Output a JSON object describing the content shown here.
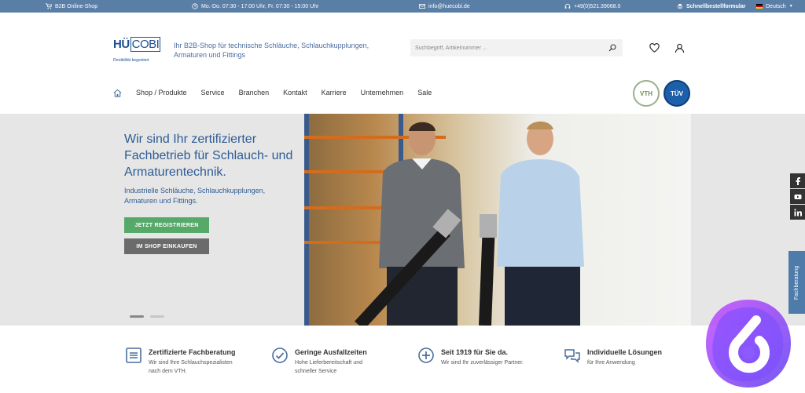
{
  "topbar": {
    "shop_label": "B2B Online-Shop",
    "hours": "Mo.-Do. 07:30 - 17:00 Uhr, Fr. 07:30 - 15:00 Uhr",
    "email": "info@huecobi.de",
    "phone": "+49(0)521.39068.0",
    "quick_order": "Schnellbestellformular",
    "language": "Deutsch"
  },
  "header": {
    "logo_hu": "HÜ",
    "logo_cobi": "COBI",
    "logo_tag": "Flexibilität begeistert",
    "tagline": "Ihr B2B-Shop für technische Schläuche, Schlauchkupplungen, Armaturen und Fittings",
    "search_placeholder": "Suchbegriff, Artikelnummer ..."
  },
  "nav": {
    "items": [
      "Shop / Produkte",
      "Service",
      "Branchen",
      "Kontakt",
      "Karriere",
      "Unternehmen",
      "Sale"
    ],
    "badge_vth": "VTH",
    "badge_tuv": "TÜV"
  },
  "hero": {
    "title": "Wir sind Ihr zertifizierter Fachbetrieb für Schlauch- und Armaturentechnik.",
    "subtitle": "Industrielle Schläuche, Schlauchkupplungen, Armaturen und Fittings.",
    "btn_register": "JETZT REGISTRIEREN",
    "btn_shop": "IM SHOP EINKAUFEN"
  },
  "sidetab": "Fachberatung",
  "features": [
    {
      "title": "Zertifizierte Fachberatung",
      "desc1": "Wir sind Ihre Schlauchspezialisten",
      "desc2": "nach dem VTH."
    },
    {
      "title": "Geringe Ausfallzeiten",
      "desc1": "Hohe Lieferbereitschaft und",
      "desc2": "schneller Service"
    },
    {
      "title": "Seit 1919 für Sie da.",
      "desc1": "Wir sind Ihr zuverlässiger Partner.",
      "desc2": ""
    },
    {
      "title": "Individuelle Lösungen",
      "desc1": "für Ihre Anwendung",
      "desc2": ""
    }
  ],
  "colors": {
    "topbar": "#5a7fa6",
    "accent_blue": "#2e5c94",
    "register_green": "#57a96a",
    "shop_gray": "#6b6b6b"
  }
}
